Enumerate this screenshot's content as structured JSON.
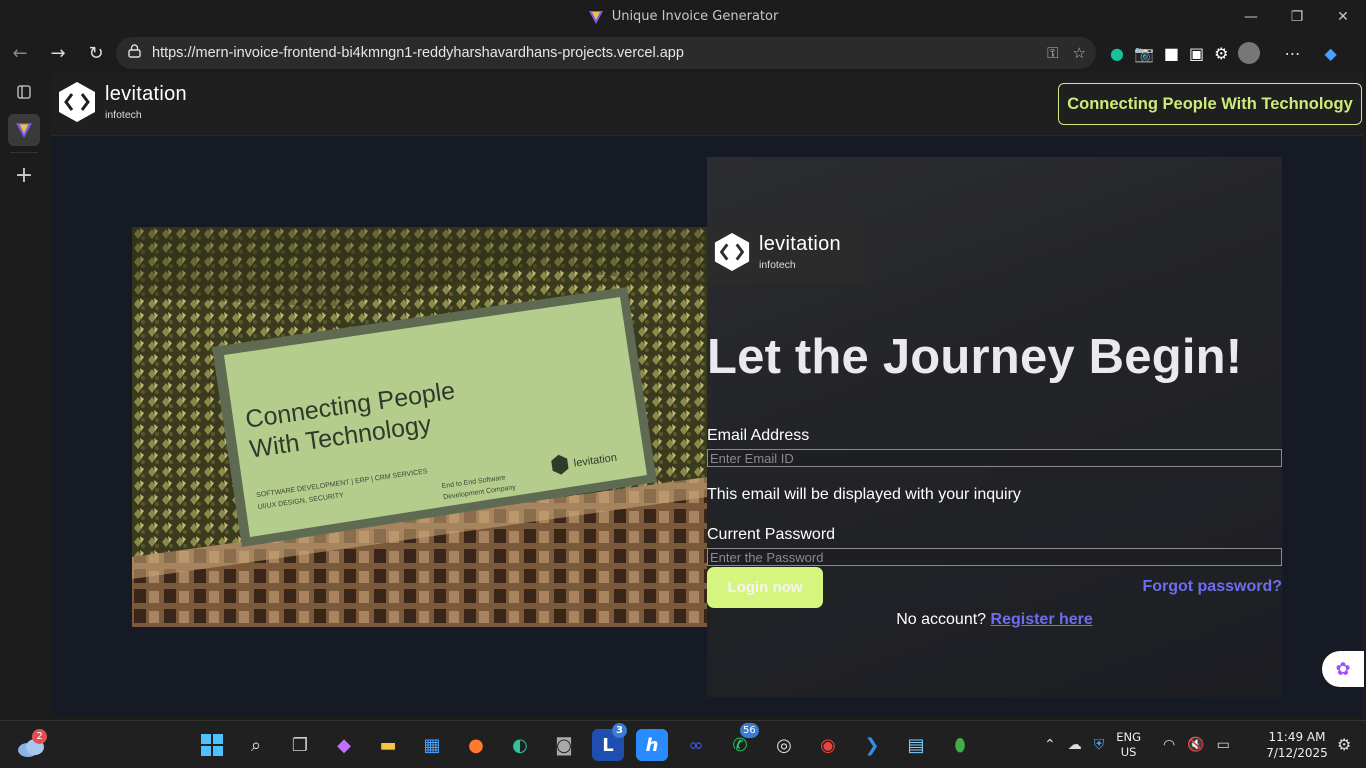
{
  "window": {
    "title": "Unique Invoice Generator",
    "controls": [
      "—",
      "❐",
      "✕"
    ]
  },
  "browser": {
    "url": "https://mern-invoice-frontend-bi4kmngn1-reddyharshavardhans-projects.vercel.app",
    "nav": [
      "←",
      "→",
      "↻"
    ]
  },
  "app": {
    "brand_name": "levitation",
    "brand_sub": "infotech",
    "tagline_button": "Connecting People With Technology"
  },
  "hero_image": {
    "sign_line1": "Connecting People",
    "sign_line2": "With Technology",
    "sign_small1": "SOFTWARE DEVELOPMENT | ERP | CRM SERVICES",
    "sign_small2": "UI/UX DESIGN, SECURITY",
    "sign_small3": "End to End Software",
    "sign_small4": "Development Company",
    "sign_brand": "levitation"
  },
  "login": {
    "brand_name": "levitation",
    "brand_sub": "infotech",
    "headline": "Let the Journey Begin!",
    "email_label": "Email Address",
    "email_placeholder": "Enter Email ID",
    "email_hint": "This email will be displayed with your inquiry",
    "password_label": "Current Password",
    "password_placeholder": "Enter the Password",
    "login_button": "Login now",
    "forgot_link": "Forgot password?",
    "no_account_text": "No account?",
    "register_link": "Register here"
  },
  "taskbar": {
    "weather_badge": "2",
    "badge_l": "3",
    "badge_whatsapp": "56",
    "lang_line1": "ENG",
    "lang_line2": "US",
    "time": "11:49 AM",
    "date": "7/12/2025"
  },
  "colors": {
    "accent_green": "#cdea7a",
    "button_green": "#d6f57e",
    "link_purple": "#6d6df0",
    "page_bg": "#161a24"
  }
}
